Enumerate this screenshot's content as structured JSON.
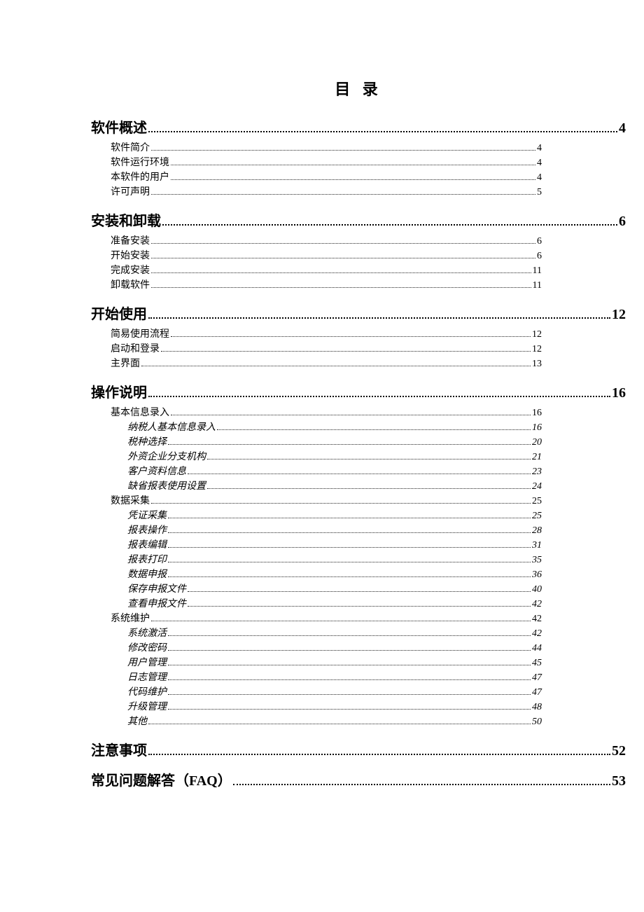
{
  "title": "目 录",
  "toc": [
    {
      "label": "软件概述",
      "page": "4",
      "children": [
        {
          "label": "软件简介",
          "page": "4"
        },
        {
          "label": "软件运行环境",
          "page": "4"
        },
        {
          "label": "本软件的用户",
          "page": "4"
        },
        {
          "label": "许可声明",
          "page": "5"
        }
      ]
    },
    {
      "label": "安装和卸载",
      "page": "6",
      "children": [
        {
          "label": "准备安装",
          "page": "6"
        },
        {
          "label": "开始安装",
          "page": "6"
        },
        {
          "label": "完成安装",
          "page": "11"
        },
        {
          "label": "卸载软件",
          "page": "11"
        }
      ]
    },
    {
      "label": "开始使用",
      "page": "12",
      "children": [
        {
          "label": "简易使用流程",
          "page": "12"
        },
        {
          "label": "启动和登录",
          "page": "12"
        },
        {
          "label": "主界面",
          "page": "13"
        }
      ]
    },
    {
      "label": "操作说明",
      "page": "16",
      "children": [
        {
          "label": "基本信息录入",
          "page": "16",
          "children": [
            {
              "label": "纳税人基本信息录入",
              "page": "16"
            },
            {
              "label": "税种选择",
              "page": "20"
            },
            {
              "label": "外资企业分支机构",
              "page": "21"
            },
            {
              "label": "客户资料信息",
              "page": "23"
            },
            {
              "label": "缺省报表使用设置",
              "page": "24"
            }
          ]
        },
        {
          "label": "数据采集",
          "page": "25",
          "children": [
            {
              "label": "凭证采集",
              "page": "25"
            },
            {
              "label": "报表操作",
              "page": "28"
            },
            {
              "label": "报表编辑",
              "page": "31"
            },
            {
              "label": "报表打印",
              "page": "35"
            },
            {
              "label": "数据申报",
              "page": "36"
            },
            {
              "label": "保存申报文件",
              "page": "40"
            },
            {
              "label": "查看申报文件",
              "page": "42"
            }
          ]
        },
        {
          "label": "系统维护",
          "page": "42",
          "children": [
            {
              "label": "系统激活",
              "page": "42"
            },
            {
              "label": "修改密码",
              "page": "44"
            },
            {
              "label": "用户管理",
              "page": "45"
            },
            {
              "label": "日志管理",
              "page": "47"
            },
            {
              "label": "代码维护",
              "page": "47"
            },
            {
              "label": "升级管理",
              "page": "48"
            },
            {
              "label": "其他",
              "page": "50"
            }
          ]
        }
      ]
    },
    {
      "label": "注意事项",
      "page": "52"
    },
    {
      "label": "常见问题解答（FAQ）",
      "page": "53"
    }
  ]
}
